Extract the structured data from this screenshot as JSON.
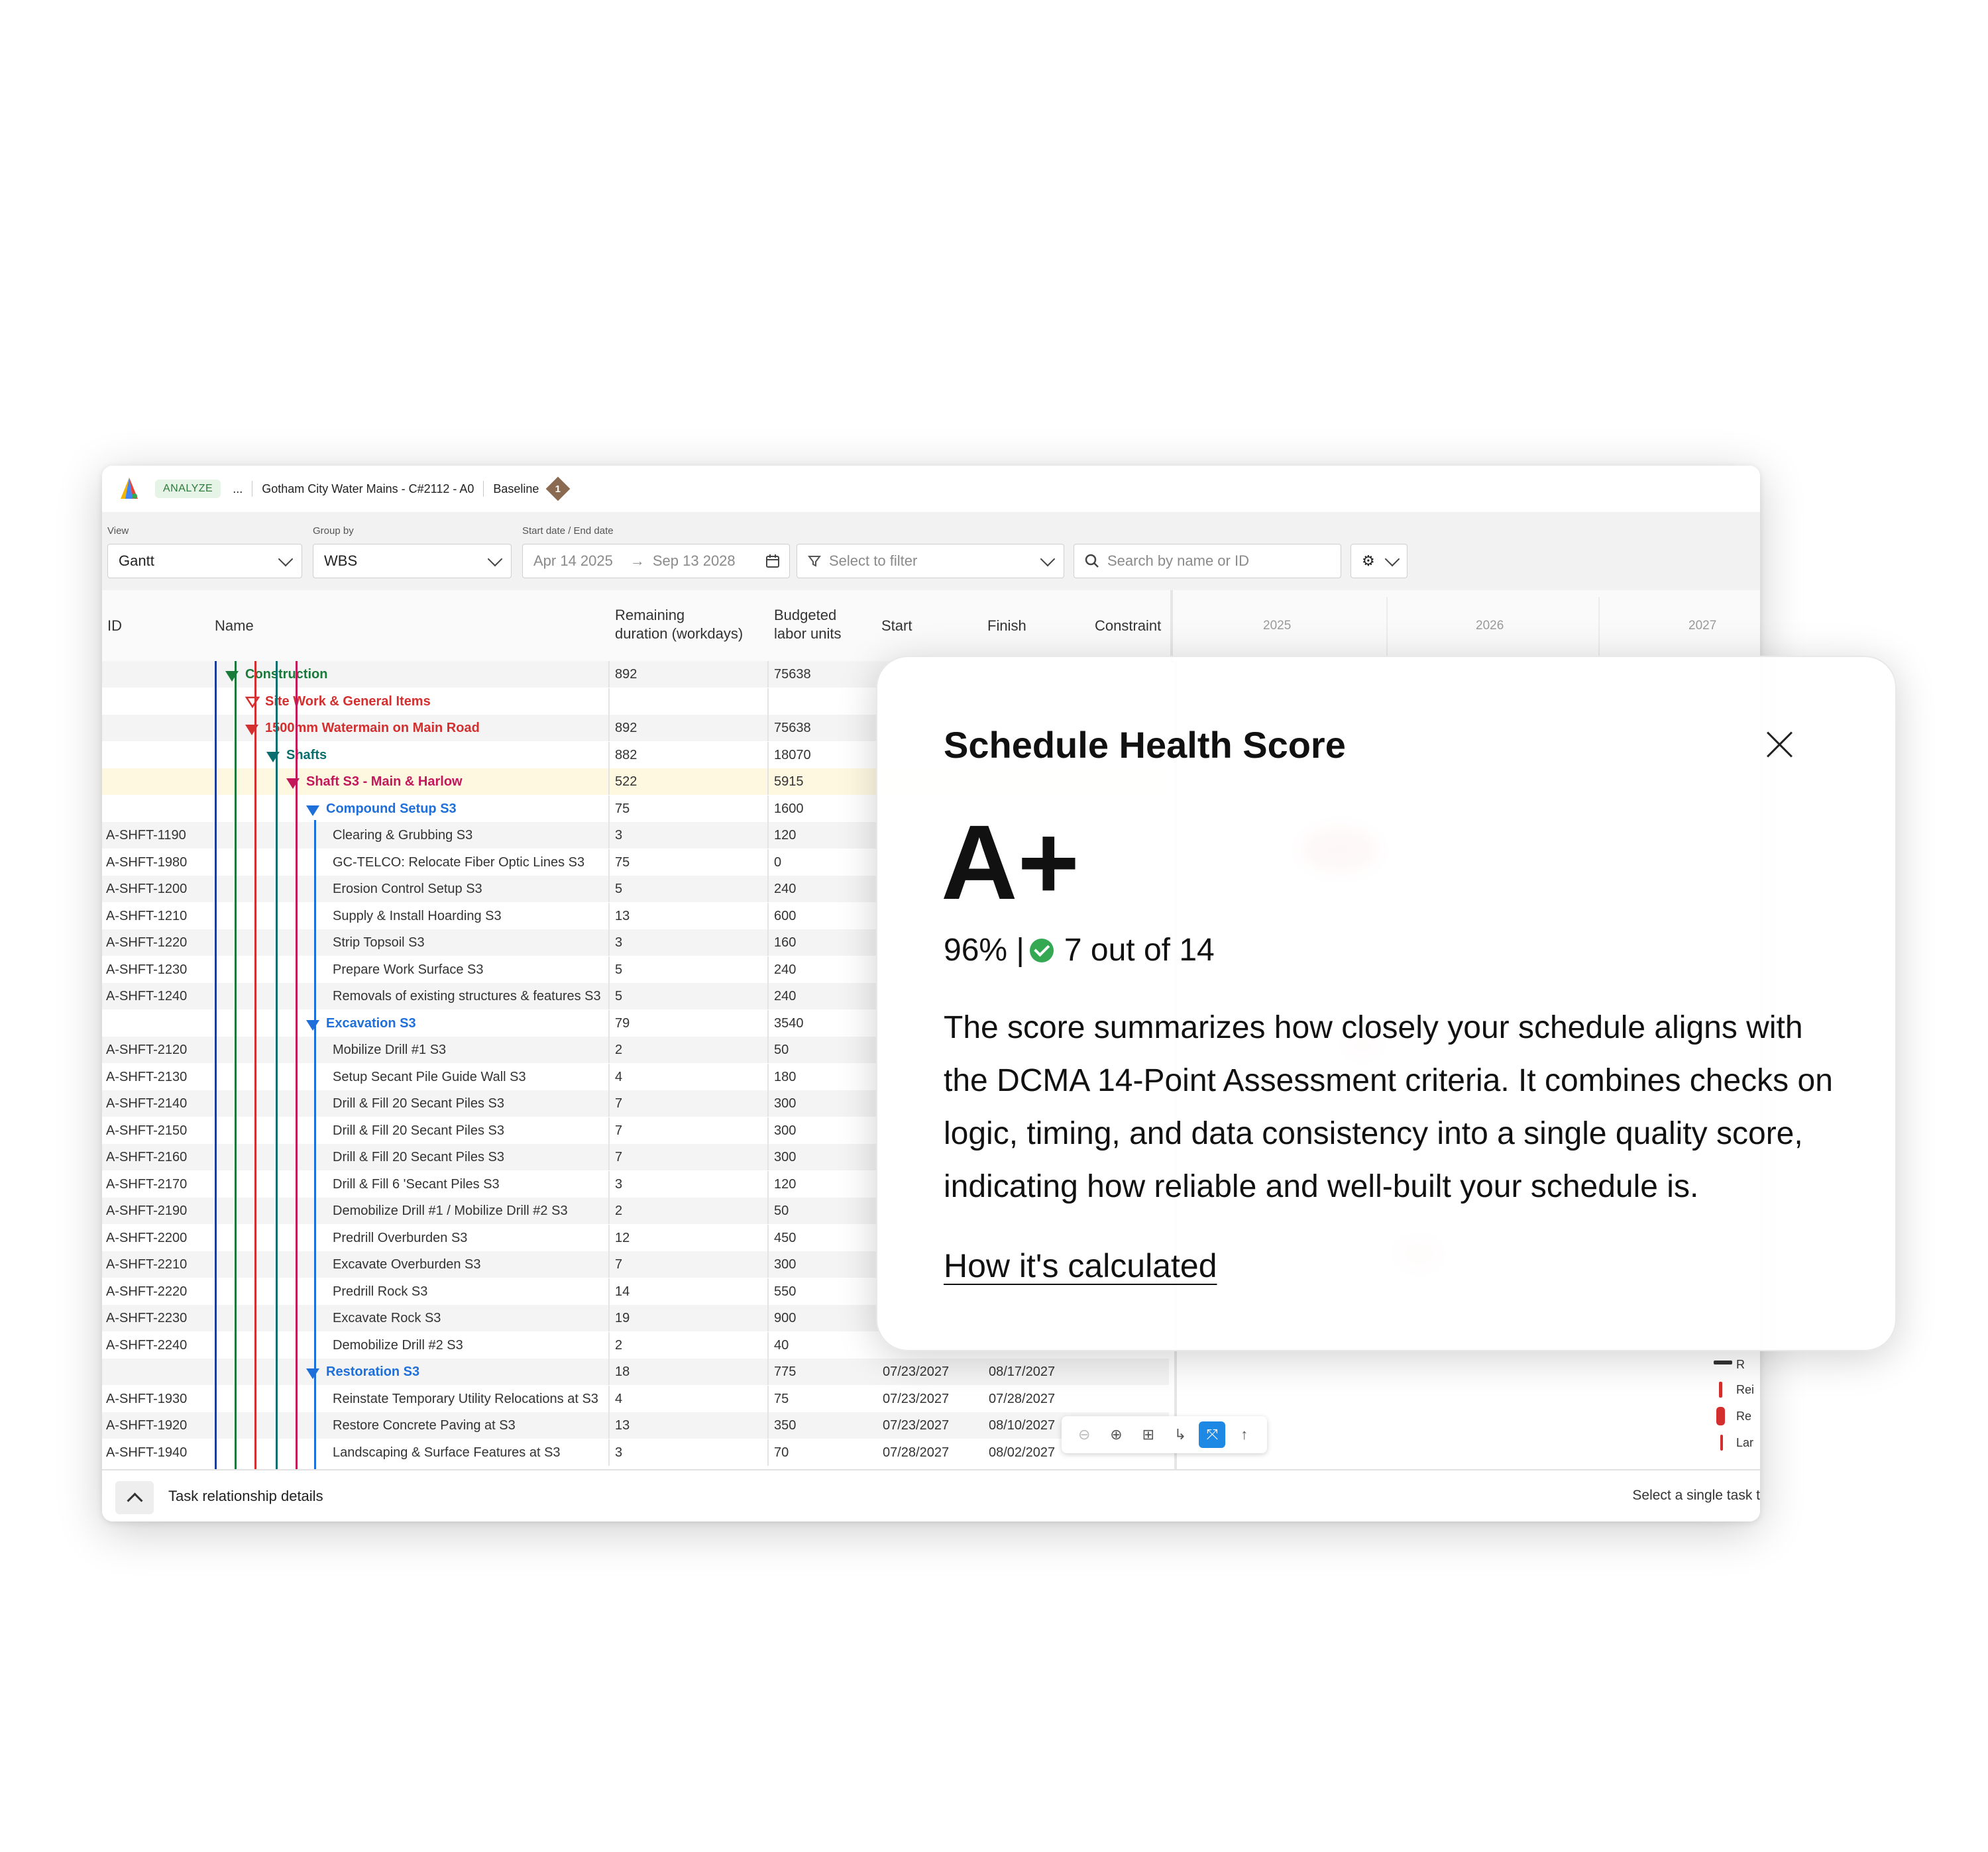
{
  "header": {
    "chip": "ANALYZE",
    "ellipsis": "...",
    "project": "Gotham City Water Mains - C#2112 - A0",
    "baseline": "Baseline",
    "badge": "1"
  },
  "controls": {
    "view_label": "View",
    "view_value": "Gantt",
    "group_label": "Group by",
    "group_value": "WBS",
    "date_label": "Start date  /  End date",
    "start_date": "Apr 14 2025",
    "end_date": "Sep 13 2028",
    "filter_placeholder": "Select to filter",
    "search_placeholder": "Search by name or ID"
  },
  "columns": {
    "id": "ID",
    "name": "Name",
    "remaining_1": "Remaining",
    "remaining_2": "duration (workdays)",
    "budget_1": "Budgeted",
    "budget_2": "labor units",
    "start": "Start",
    "finish": "Finish",
    "constraint": "Constraint",
    "years": [
      "2025",
      "2026",
      "2027"
    ]
  },
  "rows": [
    {
      "id": "",
      "name": "Construction",
      "dur": "892",
      "units": "75638",
      "start": "",
      "finish": ""
    },
    {
      "id": "",
      "name": "Site Work & General Items",
      "dur": "",
      "units": "",
      "start": "",
      "finish": ""
    },
    {
      "id": "",
      "name": "1500mm Watermain on Main Road",
      "dur": "892",
      "units": "75638",
      "start": "",
      "finish": ""
    },
    {
      "id": "",
      "name": "Shafts",
      "dur": "882",
      "units": "18070",
      "start": "",
      "finish": ""
    },
    {
      "id": "",
      "name": "Shaft S3 - Main & Harlow",
      "dur": "522",
      "units": "5915",
      "start": "",
      "finish": ""
    },
    {
      "id": "",
      "name": "Compound Setup S3",
      "dur": "75",
      "units": "1600",
      "start": "",
      "finish": ""
    },
    {
      "id": "A-SHFT-1190",
      "name": "Clearing & Grubbing S3",
      "dur": "3",
      "units": "120",
      "start": "",
      "finish": ""
    },
    {
      "id": "A-SHFT-1980",
      "name": "GC-TELCO: Relocate Fiber Optic Lines S3",
      "dur": "75",
      "units": "0",
      "start": "",
      "finish": ""
    },
    {
      "id": "A-SHFT-1200",
      "name": "Erosion Control Setup S3",
      "dur": "5",
      "units": "240",
      "start": "",
      "finish": ""
    },
    {
      "id": "A-SHFT-1210",
      "name": "Supply & Install Hoarding S3",
      "dur": "13",
      "units": "600",
      "start": "",
      "finish": ""
    },
    {
      "id": "A-SHFT-1220",
      "name": "Strip Topsoil S3",
      "dur": "3",
      "units": "160",
      "start": "",
      "finish": ""
    },
    {
      "id": "A-SHFT-1230",
      "name": "Prepare Work Surface S3",
      "dur": "5",
      "units": "240",
      "start": "",
      "finish": ""
    },
    {
      "id": "A-SHFT-1240",
      "name": "Removals of existing structures & features S3",
      "dur": "5",
      "units": "240",
      "start": "",
      "finish": ""
    },
    {
      "id": "",
      "name": "Excavation S3",
      "dur": "79",
      "units": "3540",
      "start": "",
      "finish": ""
    },
    {
      "id": "A-SHFT-2120",
      "name": "Mobilize Drill #1 S3",
      "dur": "2",
      "units": "50",
      "start": "",
      "finish": ""
    },
    {
      "id": "A-SHFT-2130",
      "name": "Setup Secant Pile Guide Wall S3",
      "dur": "4",
      "units": "180",
      "start": "",
      "finish": ""
    },
    {
      "id": "A-SHFT-2140",
      "name": "Drill & Fill 20 Secant Piles S3",
      "dur": "7",
      "units": "300",
      "start": "",
      "finish": ""
    },
    {
      "id": "A-SHFT-2150",
      "name": "Drill & Fill 20 Secant Piles S3",
      "dur": "7",
      "units": "300",
      "start": "",
      "finish": ""
    },
    {
      "id": "A-SHFT-2160",
      "name": "Drill & Fill 20 Secant Piles S3",
      "dur": "7",
      "units": "300",
      "start": "",
      "finish": ""
    },
    {
      "id": "A-SHFT-2170",
      "name": "Drill & Fill 6 'Secant Piles S3",
      "dur": "3",
      "units": "120",
      "start": "",
      "finish": ""
    },
    {
      "id": "A-SHFT-2190",
      "name": "Demobilize Drill #1 / Mobilize Drill #2 S3",
      "dur": "2",
      "units": "50",
      "start": "",
      "finish": ""
    },
    {
      "id": "A-SHFT-2200",
      "name": "Predrill Overburden S3",
      "dur": "12",
      "units": "450",
      "start": "",
      "finish": ""
    },
    {
      "id": "A-SHFT-2210",
      "name": "Excavate Overburden S3",
      "dur": "7",
      "units": "300",
      "start": "",
      "finish": ""
    },
    {
      "id": "A-SHFT-2220",
      "name": "Predrill Rock S3",
      "dur": "14",
      "units": "550",
      "start": "",
      "finish": ""
    },
    {
      "id": "A-SHFT-2230",
      "name": "Excavate Rock S3",
      "dur": "19",
      "units": "900",
      "start": "",
      "finish": ""
    },
    {
      "id": "A-SHFT-2240",
      "name": "Demobilize Drill #2 S3",
      "dur": "2",
      "units": "40",
      "start": "",
      "finish": ""
    },
    {
      "id": "",
      "name": "Restoration S3",
      "dur": "18",
      "units": "775",
      "start": "07/23/2027",
      "finish": "08/17/2027"
    },
    {
      "id": "A-SHFT-1930",
      "name": "Reinstate Temporary Utility Relocations at S3",
      "dur": "4",
      "units": "75",
      "start": "07/23/2027",
      "finish": "07/28/2027"
    },
    {
      "id": "A-SHFT-1920",
      "name": "Restore Concrete Paving at S3",
      "dur": "13",
      "units": "350",
      "start": "07/23/2027",
      "finish": "08/10/2027"
    },
    {
      "id": "A-SHFT-1940",
      "name": "Landscaping & Surface Features at S3",
      "dur": "3",
      "units": "70",
      "start": "07/28/2027",
      "finish": "08/02/2027"
    }
  ],
  "gantt_labels": [
    "R",
    "Rei",
    "Re",
    "Lar"
  ],
  "footer": {
    "title": "Task relationship details",
    "hint": "Select a single task t"
  },
  "modal": {
    "title": "Schedule Health Score",
    "grade": "A+",
    "percent": "96% |",
    "checks": "7 out of 14",
    "description": "The score summarizes how closely your schedule aligns with the DCMA 14-Point Assessment criteria. It combines checks on logic, timing, and data consistency into a single quality score, indicating how reliable and well-built your schedule is.",
    "link": "How it's calculated"
  },
  "colors": {
    "green": "#1a7a3a",
    "red": "#d32f2f",
    "teal": "#0b6e6e",
    "magenta": "#c2185b",
    "blue": "#1e6fd9",
    "accent": "#1e88e5"
  }
}
